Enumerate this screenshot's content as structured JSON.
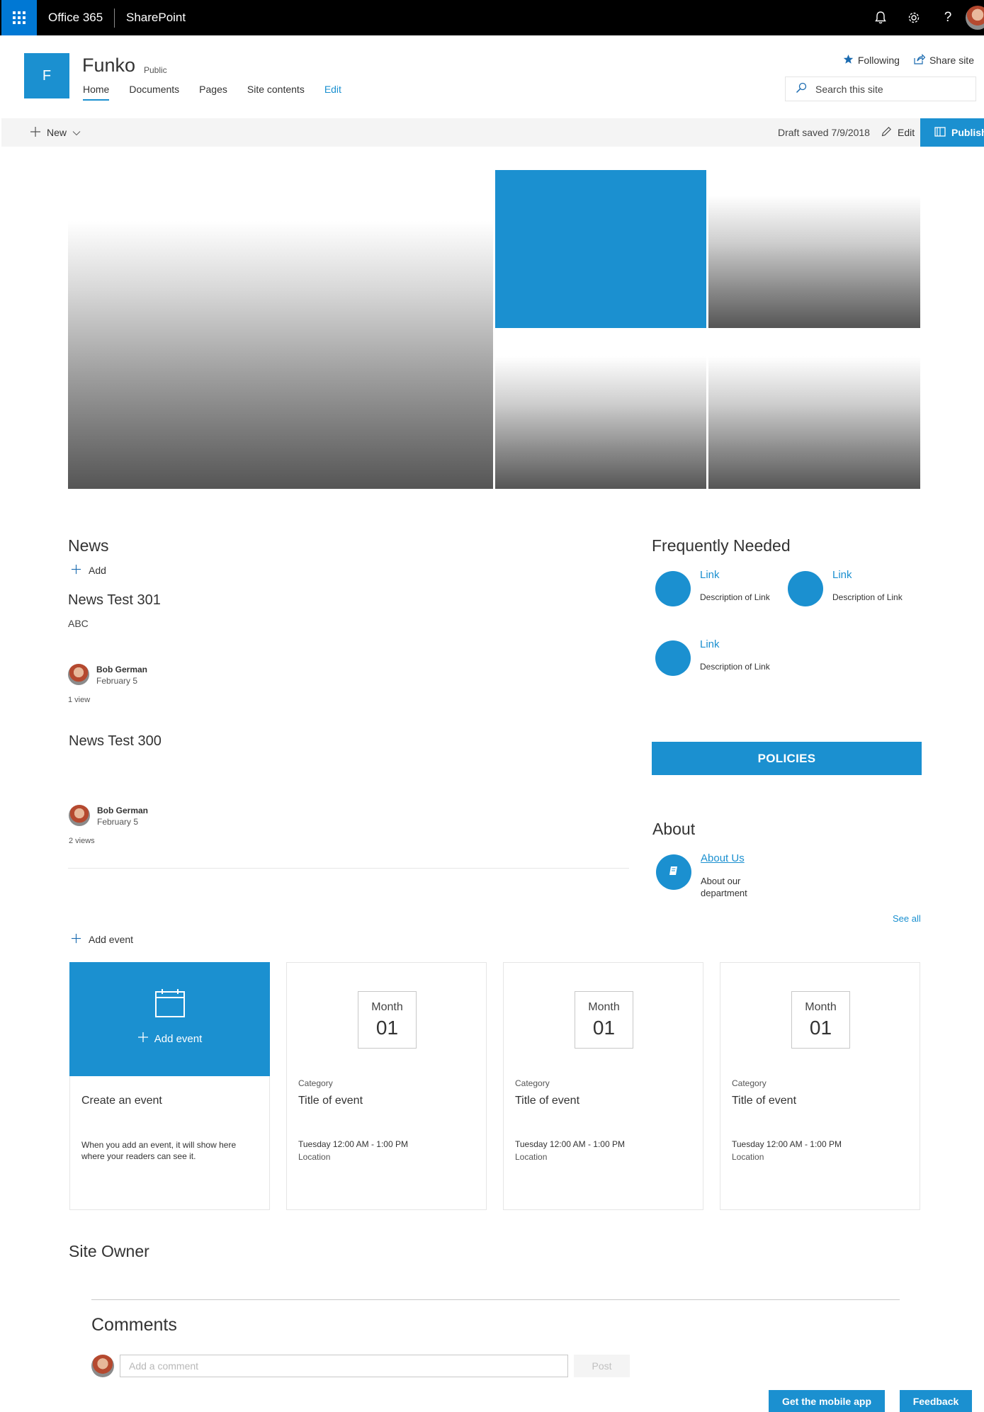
{
  "suitebar": {
    "app_name": "Office 365",
    "product_name": "SharePoint",
    "icons": [
      "waffle-icon",
      "bell-icon",
      "gear-icon",
      "help-icon",
      "avatar"
    ]
  },
  "site": {
    "logo_letter": "F",
    "title": "Funko",
    "privacy": "Public",
    "nav": [
      {
        "label": "Home",
        "active": true
      },
      {
        "label": "Documents",
        "active": false
      },
      {
        "label": "Pages",
        "active": false
      },
      {
        "label": "Site contents",
        "active": false
      },
      {
        "label": "Edit",
        "active": false
      }
    ],
    "following_label": "Following",
    "share_label": "Share site",
    "search_placeholder": "Search this site"
  },
  "commandbar": {
    "new_label": "New",
    "draft_status": "Draft saved 7/9/2018",
    "edit_label": "Edit",
    "publish_label": "Publish"
  },
  "news": {
    "title": "News",
    "add_label": "Add",
    "items": [
      {
        "title": "News Test 301",
        "description": "ABC",
        "author": "Bob German",
        "date": "February 5",
        "views": "1 view"
      },
      {
        "title": "News Test 300",
        "description": "",
        "author": "Bob German",
        "date": "February 5",
        "views": "2 views"
      }
    ]
  },
  "quicklinks": {
    "title": "Frequently Needed",
    "items": [
      {
        "title": "Link",
        "description": "Description of Link"
      },
      {
        "title": "Link",
        "description": "Description of Link"
      },
      {
        "title": "Link",
        "description": "Description of Link"
      }
    ],
    "policies_label": "POLICIES"
  },
  "about": {
    "title": "About",
    "link_label": "About Us",
    "description": "About our department",
    "see_all": "See all"
  },
  "events": {
    "add_label": "Add event",
    "create_card": {
      "hero_label": "Add event",
      "title": "Create an event",
      "description": "When you add an event, it will show here where your readers can see it."
    },
    "items": [
      {
        "month": "Month",
        "day": "01",
        "category": "Category",
        "title": "Title of event",
        "time": "Tuesday 12:00 AM - 1:00 PM",
        "location": "Location"
      },
      {
        "month": "Month",
        "day": "01",
        "category": "Category",
        "title": "Title of event",
        "time": "Tuesday 12:00 AM - 1:00 PM",
        "location": "Location"
      },
      {
        "month": "Month",
        "day": "01",
        "category": "Category",
        "title": "Title of event",
        "time": "Tuesday 12:00 AM - 1:00 PM",
        "location": "Location"
      }
    ]
  },
  "site_owner": {
    "title": "Site Owner"
  },
  "comments": {
    "title": "Comments",
    "placeholder": "Add a comment",
    "post_label": "Post"
  },
  "footer": {
    "mobile_app_label": "Get the mobile app",
    "feedback_label": "Feedback"
  },
  "colors": {
    "accent": "#1b90d0",
    "suitebar": "#000000",
    "waffle": "#0078d4"
  }
}
